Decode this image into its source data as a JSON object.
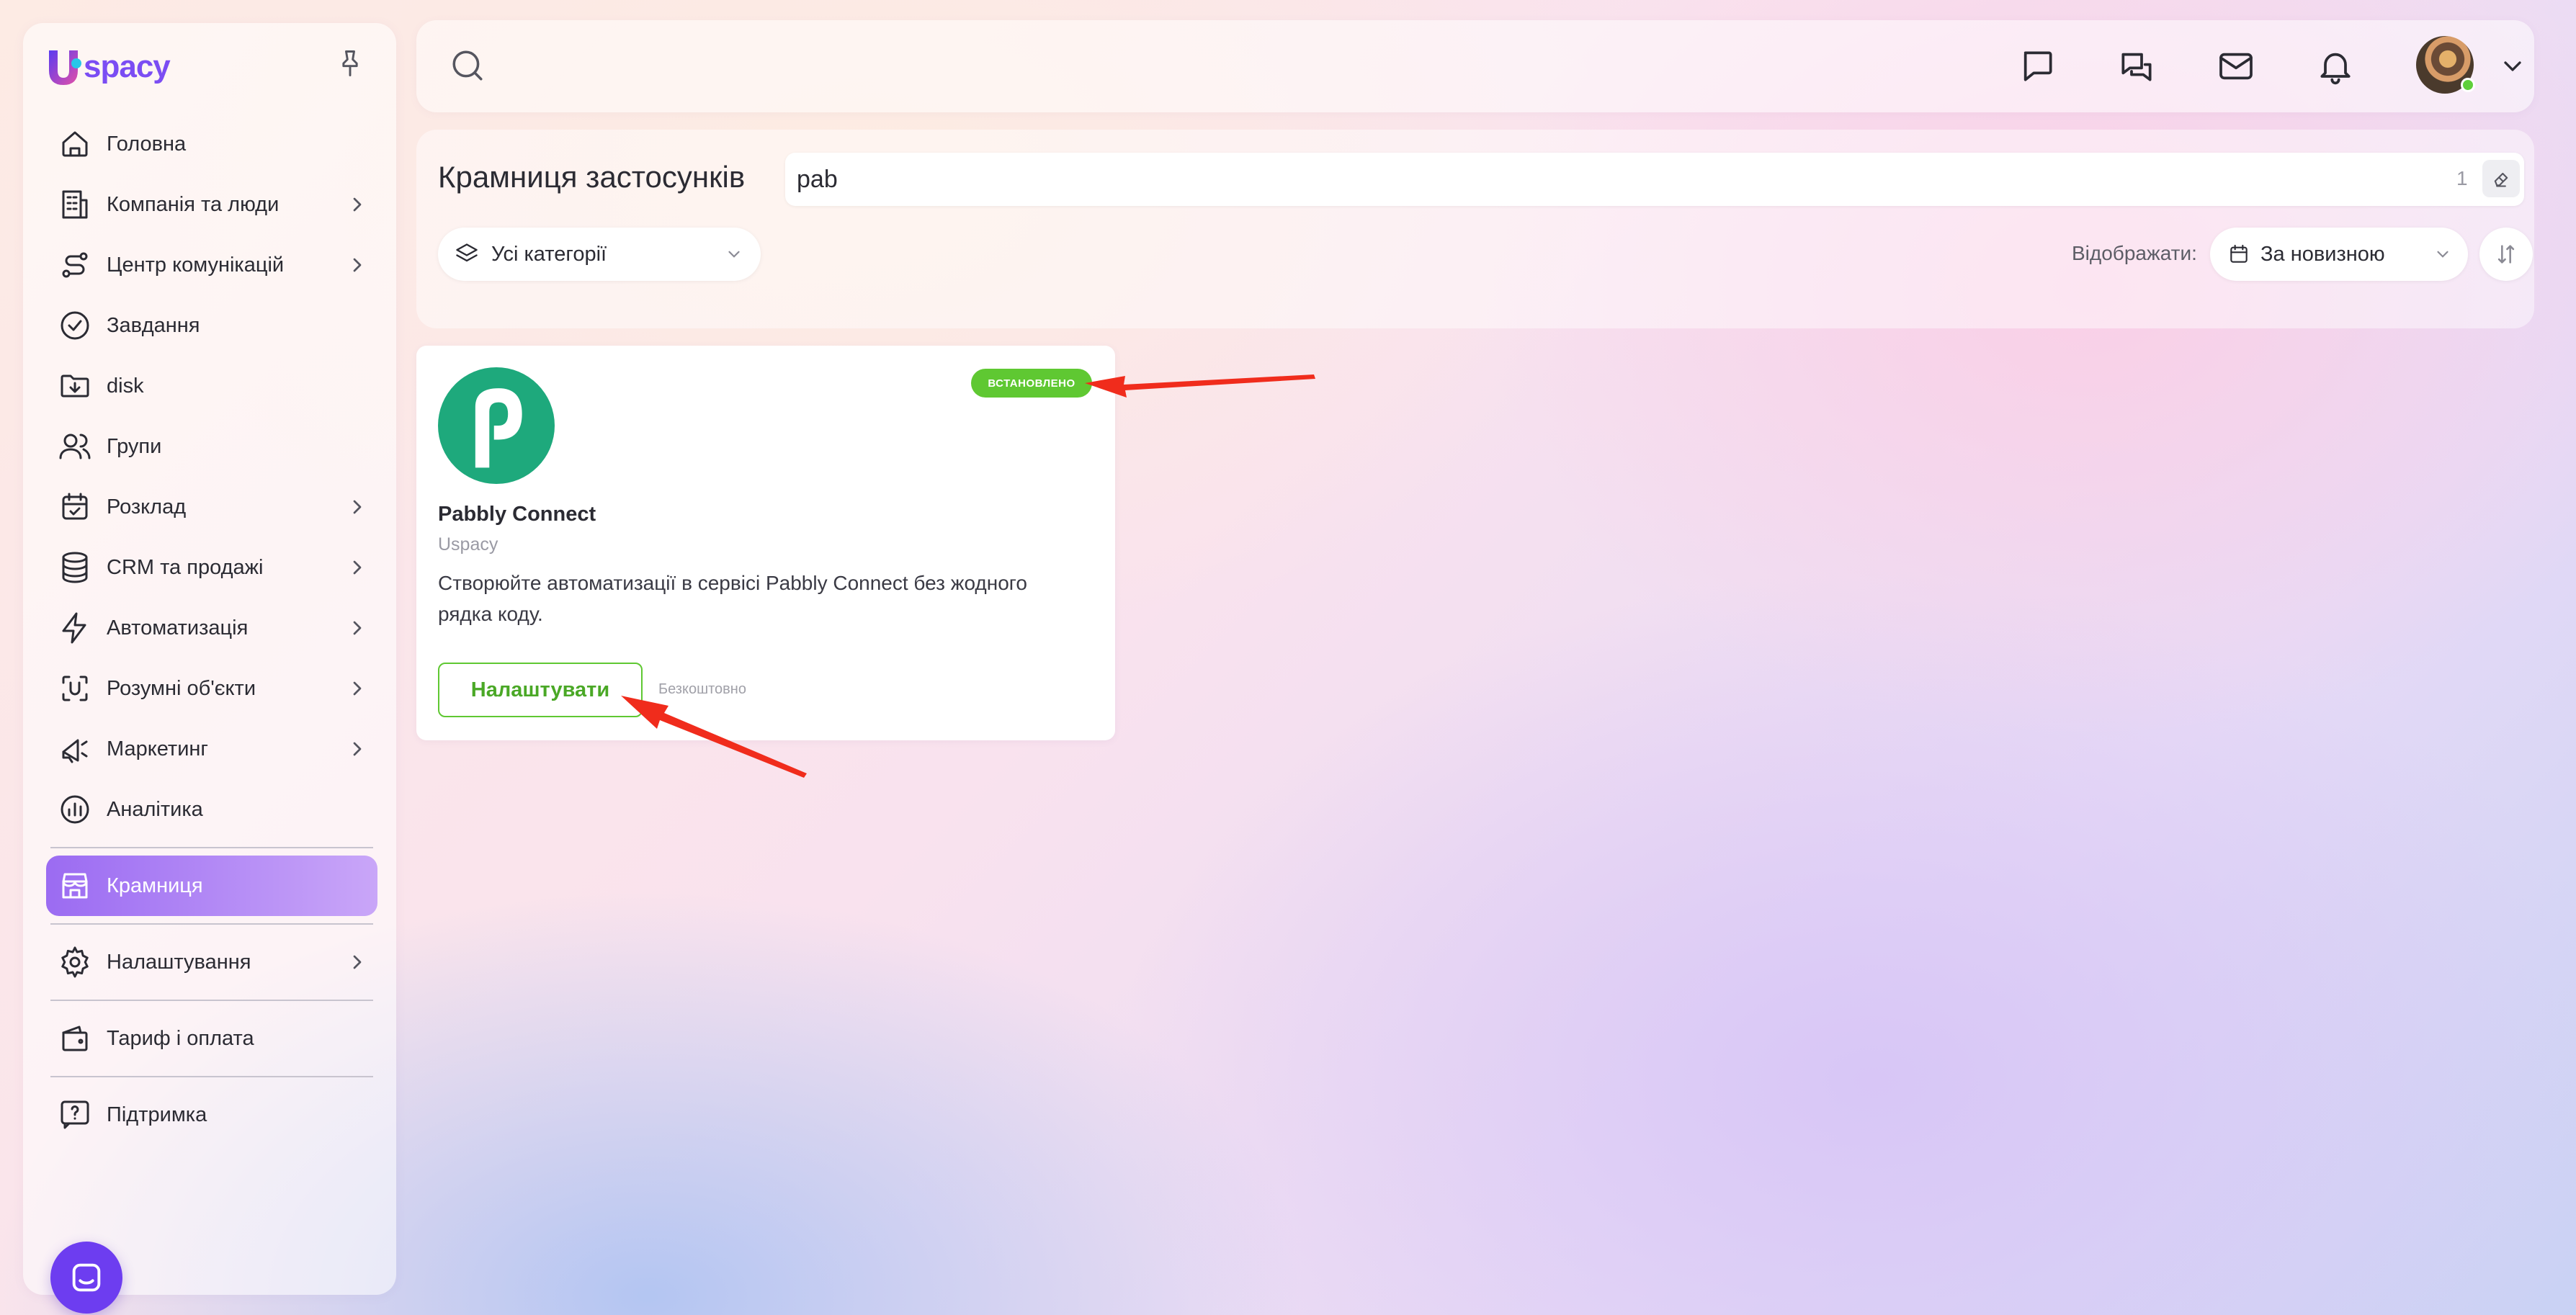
{
  "colors": {
    "accent": "#7b4df3",
    "active_nav_start": "#9b6bf2",
    "active_nav_end": "#c9a6f8",
    "installed_badge": "#5fc832",
    "app_logo": "#1ea97c",
    "annotation_arrow": "#f02c1c"
  },
  "sidebar": {
    "logo_text": "spacy",
    "logo_icon": "uspacy-u-logo",
    "pin_icon": "pin-icon",
    "items": [
      {
        "label": "Головна",
        "icon": "home-icon",
        "has_submenu": false
      },
      {
        "label": "Компанія та люди",
        "icon": "building-icon",
        "has_submenu": true
      },
      {
        "label": "Центр комунікацій",
        "icon": "route-icon",
        "has_submenu": true
      },
      {
        "label": "Завдання",
        "icon": "check-circle-icon",
        "has_submenu": false
      },
      {
        "label": "disk",
        "icon": "folder-download-icon",
        "has_submenu": false
      },
      {
        "label": "Групи",
        "icon": "users-icon",
        "has_submenu": false
      },
      {
        "label": "Розклад",
        "icon": "calendar-check-icon",
        "has_submenu": true
      },
      {
        "label": "CRM та продажі",
        "icon": "database-icon",
        "has_submenu": true
      },
      {
        "label": "Автоматизація",
        "icon": "lightning-icon",
        "has_submenu": true
      },
      {
        "label": "Розумні об'єкти",
        "icon": "scan-icon",
        "has_submenu": true
      },
      {
        "label": "Маркетинг",
        "icon": "megaphone-icon",
        "has_submenu": true
      },
      {
        "label": "Аналітика",
        "icon": "chart-circle-icon",
        "has_submenu": false
      },
      {
        "label": "Крамниця",
        "icon": "store-icon",
        "has_submenu": false,
        "active": true
      },
      {
        "label": "Налаштування",
        "icon": "gear-icon",
        "has_submenu": true
      },
      {
        "label": "Тариф і оплата",
        "icon": "wallet-icon",
        "has_submenu": false
      },
      {
        "label": "Підтримка",
        "icon": "help-chat-icon",
        "has_submenu": false
      }
    ]
  },
  "topbar": {
    "icons": [
      "search-icon",
      "chat-icon",
      "messages-icon",
      "mail-icon",
      "bell-icon",
      "chevron-down-icon"
    ],
    "user_online": true
  },
  "store": {
    "title": "Крамниця застосунків",
    "search": {
      "value": "pab",
      "count": "1"
    },
    "category": {
      "selected": "Усі категорії"
    },
    "show_label": "Відображати:",
    "sort": {
      "selected": "За новизною"
    }
  },
  "app_card": {
    "badge": "ВСТАНОВЛЕНО",
    "name": "Pabbly Connect",
    "vendor": "Uspacy",
    "description": "Створюйте автоматизації в сервісі Pabbly Connect без жодного рядка коду.",
    "button": "Налаштувати",
    "price": "Безкоштовно"
  }
}
